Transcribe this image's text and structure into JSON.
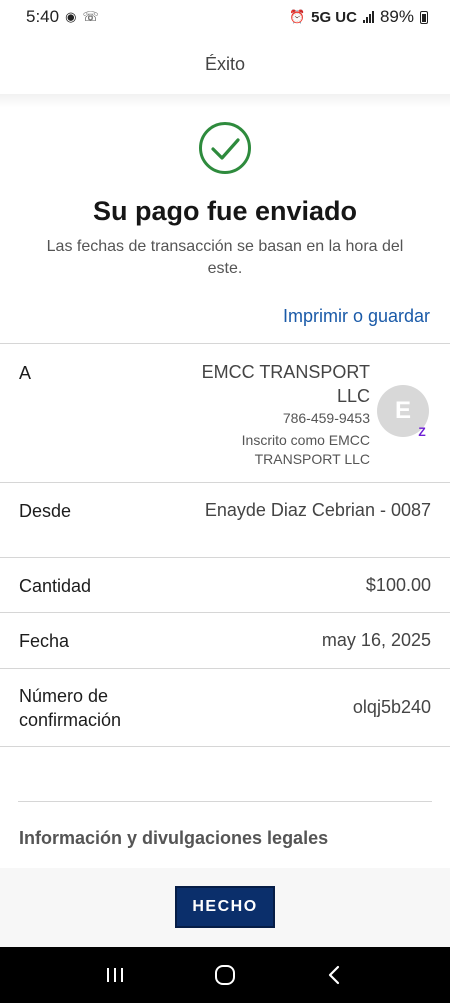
{
  "status": {
    "time": "5:40",
    "network": "5G UC",
    "battery": "89%"
  },
  "header": {
    "title": "Éxito"
  },
  "confirmation": {
    "title": "Su pago fue enviado",
    "subtitle": "Las fechas de transacción se basan en la hora del este.",
    "print_link": "Imprimir o guardar"
  },
  "payee": {
    "label": "A",
    "name": "EMCC TRANSPORT LLC",
    "phone": "786-459-9453",
    "enrolled": "Inscrito como EMCC TRANSPORT LLC",
    "avatar_initial": "E",
    "badge": "Z"
  },
  "from": {
    "label": "Desde",
    "value": "Enayde Diaz Cebrian - 0087"
  },
  "amount": {
    "label": "Cantidad",
    "value": "$100.00"
  },
  "date": {
    "label": "Fecha",
    "value": "may 16, 2025"
  },
  "confirmation_number": {
    "label": "Número de confirmación",
    "value": "olqj5b240"
  },
  "legal": {
    "label": "Información y divulgaciones legales"
  },
  "footer": {
    "done_label": "HECHO"
  },
  "colors": {
    "success_green": "#2e8b3d",
    "link_blue": "#1a5aa8",
    "button_navy": "#0b2f6b",
    "zelle_purple": "#6d1ed4"
  }
}
